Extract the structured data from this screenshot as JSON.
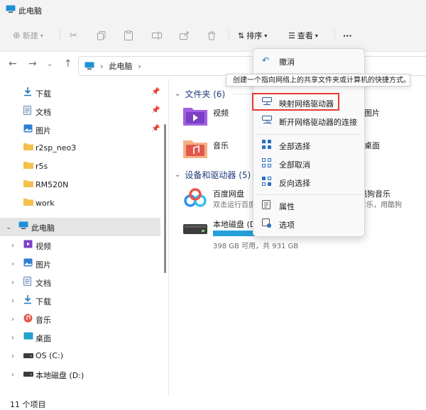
{
  "window": {
    "title": "此电脑"
  },
  "toolbar": {
    "new_label": "新建",
    "sort_label": "排序",
    "view_label": "查看",
    "more_label": "···"
  },
  "address": {
    "location": "此电脑",
    "separator": "›"
  },
  "sidebar": {
    "quick_access": [
      {
        "label": "下载",
        "icon": "download-icon",
        "pinned": true
      },
      {
        "label": "文档",
        "icon": "document-icon",
        "pinned": true
      },
      {
        "label": "图片",
        "icon": "pictures-icon",
        "pinned": true
      },
      {
        "label": "r2sp_neo3",
        "icon": "folder-icon"
      },
      {
        "label": "r5s",
        "icon": "folder-icon"
      },
      {
        "label": "RM520N",
        "icon": "folder-icon"
      },
      {
        "label": "work",
        "icon": "folder-icon"
      }
    ],
    "this_pc": {
      "label": "此电脑",
      "icon": "computer-icon"
    },
    "this_pc_children": [
      {
        "label": "视频",
        "icon": "video-folder-icon"
      },
      {
        "label": "图片",
        "icon": "pictures-icon"
      },
      {
        "label": "文档",
        "icon": "document-icon"
      },
      {
        "label": "下载",
        "icon": "download-icon"
      },
      {
        "label": "音乐",
        "icon": "music-icon"
      },
      {
        "label": "桌面",
        "icon": "desktop-icon"
      },
      {
        "label": "OS (C:)",
        "icon": "drive-icon"
      },
      {
        "label": "本地磁盘 (D:)",
        "icon": "drive-icon"
      }
    ]
  },
  "content": {
    "folders_header": "文件夹 (6)",
    "folders": [
      {
        "label": "视频",
        "icon": "video-folder-icon"
      },
      {
        "label": "音乐",
        "icon": "music-icon"
      }
    ],
    "folders_right_partial": [
      "图片",
      "桌面"
    ],
    "devices_header": "设备和驱动器 (5)",
    "devices": [
      {
        "label": "百度网盘",
        "sub": "双击运行百度"
      },
      {
        "label": "本地磁盘 (D:",
        "sub": "398 GB 可用，共 931 GB",
        "usage_fraction": 0.57
      }
    ],
    "devices_right_partial": {
      "label": "酷狗音乐",
      "sub": "音乐，用酷狗"
    }
  },
  "status": {
    "text": "11 个项目"
  },
  "context_menu": {
    "items": [
      {
        "label": "撤消",
        "icon": "undo-icon"
      },
      {
        "label": "映射网络驱动器",
        "icon": "map-network-drive-icon",
        "highlighted": true
      },
      {
        "label": "断开网络驱动器的连接",
        "icon": "disconnect-network-drive-icon"
      },
      {
        "label": "全部选择",
        "icon": "select-all-icon"
      },
      {
        "label": "全部取消",
        "icon": "select-none-icon"
      },
      {
        "label": "反向选择",
        "icon": "invert-selection-icon"
      },
      {
        "label": "属性",
        "icon": "properties-icon"
      },
      {
        "label": "选项",
        "icon": "options-icon"
      }
    ]
  },
  "tooltip": {
    "text": "创建一个指向网络上的共享文件夹或计算机的快捷方式。"
  },
  "colors": {
    "accent": "#0067c0",
    "highlight_border": "#e53935",
    "section_header": "#1f3d7a",
    "folder_yellow": "#f4c04e"
  }
}
